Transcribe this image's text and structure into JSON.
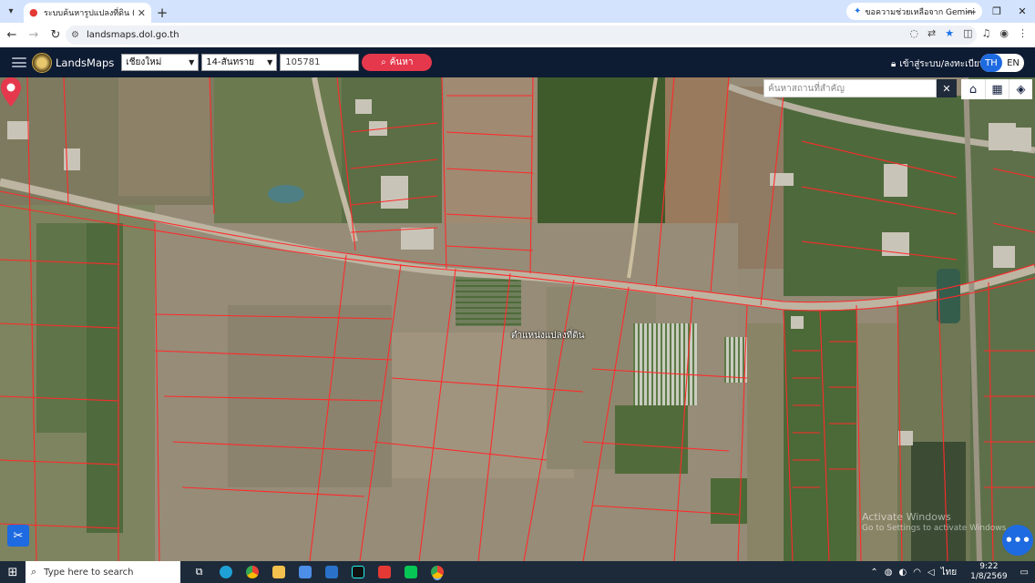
{
  "browser": {
    "tab_title": "ระบบค้นหารูปแปลงที่ดิน (LandsMaps)",
    "gemini_label": "ขอความช่วยเหลือจาก Gemini",
    "url": "landsmaps.dol.go.th",
    "tab_close": "✕",
    "new_tab": "+"
  },
  "app": {
    "brand": "LandsMaps",
    "province": "เชียงใหม่",
    "district": "14-สันทราย",
    "parcel_number": "105781",
    "search_label": "ค้นหา",
    "login_label": "เข้าสู่ระบบ/ลงทะเบียน",
    "lang_th": "TH",
    "lang_en": "EN"
  },
  "map": {
    "place_search_placeholder": "ค้นหาสถานที่สำคัญ",
    "marker_label": "ตำแหน่งแปลงที่ดิน",
    "watermark_title": "Activate Windows",
    "watermark_sub": "Go to Settings to activate Windows.",
    "fab_label": "•••"
  },
  "taskbar": {
    "search_placeholder": "Type here to search",
    "time": "9:22",
    "date": "1/8/2569",
    "lang": "ไทย"
  },
  "colors": {
    "app_header": "#0d1b33",
    "accent_red": "#e5384c",
    "accent_blue": "#1e6ae0",
    "parcel_line": "#ff2a2a"
  }
}
